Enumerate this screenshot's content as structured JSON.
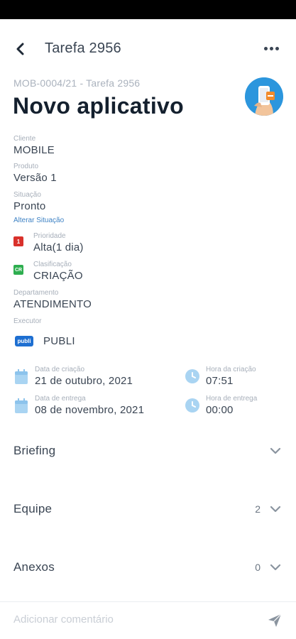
{
  "header": {
    "title": "Tarefa 2956"
  },
  "task": {
    "subtitle": "MOB-0004/21 - Tarefa 2956",
    "title": "Novo aplicativo"
  },
  "fields": {
    "cliente": {
      "label": "Cliente",
      "value": "MOBILE"
    },
    "produto": {
      "label": "Produto",
      "value": "Versão 1"
    },
    "situacao": {
      "label": "Situação",
      "value": "Pronto"
    },
    "alterar_situacao": "Alterar Situação",
    "prioridade": {
      "label": "Prioridade",
      "value": "Alta(1 dia)",
      "badge": "1",
      "badge_color": "#d9312b"
    },
    "classificacao": {
      "label": "Clasificação",
      "value": "CRIAÇÃO",
      "badge": "CR",
      "badge_color": "#2eae4f"
    },
    "departamento": {
      "label": "Departamento",
      "value": "ATENDIMENTO"
    },
    "executor": {
      "label": "Executor",
      "name": "PUBLI",
      "badge": "publi"
    }
  },
  "dates": {
    "data_criacao": {
      "label": "Data de criação",
      "value": "21 de outubro, 2021"
    },
    "hora_criacao": {
      "label": "Hora da criação",
      "value": "07:51"
    },
    "data_entrega": {
      "label": "Data de entrega",
      "value": "08 de novembro, 2021"
    },
    "hora_entrega": {
      "label": "Hora de entrega",
      "value": "00:00"
    }
  },
  "sections": {
    "briefing": {
      "title": "Briefing"
    },
    "equipe": {
      "title": "Equipe",
      "count": "2"
    },
    "anexos": {
      "title": "Anexos",
      "count": "0"
    }
  },
  "comment": {
    "placeholder": "Adicionar comentário"
  },
  "colors": {
    "accent_icon": "#a9d4f2",
    "link": "#3d82c4",
    "avatar_bg": "#2c96dd"
  }
}
